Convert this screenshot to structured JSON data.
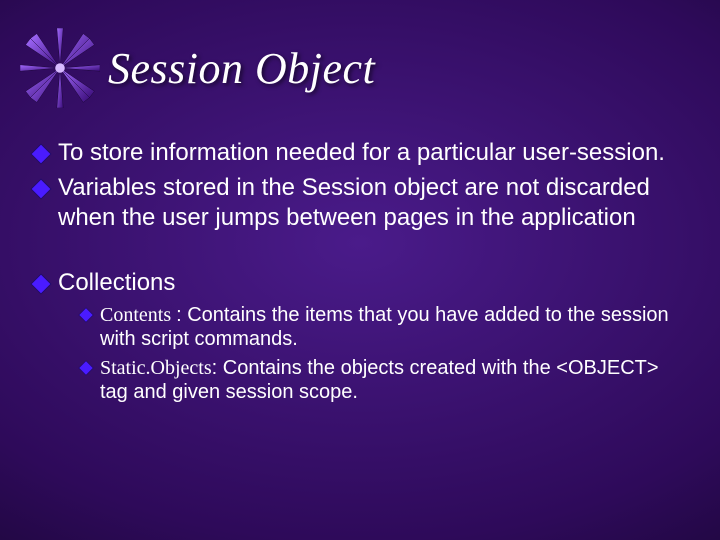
{
  "title": "Session Object",
  "bullets": {
    "b1": "To store information needed for a particular user-session.",
    "b2": "Variables stored in the Session object are not discarded when the user jumps between pages in the application",
    "b3": "Collections",
    "sub1_code": "Contents ",
    "sub1_rest": ": Contains the items that you have added to the session with script commands.",
    "sub2_code": "Static.Objects",
    "sub2_rest": ": Contains the objects created with the <OBJECT> tag and given session scope."
  }
}
